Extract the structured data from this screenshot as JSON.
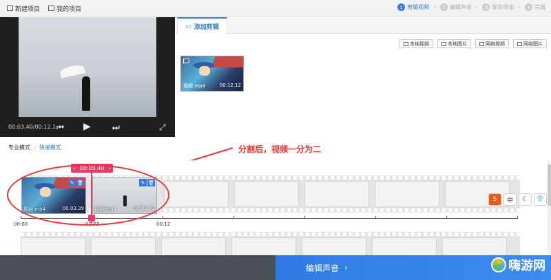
{
  "topbar": {
    "new_project": "新建项目",
    "my_projects": "我的项目",
    "steps": [
      {
        "num": "1",
        "label": "剪辑视频",
        "active": true
      },
      {
        "num": "2",
        "label": "编辑声音",
        "active": false
      },
      {
        "num": "3",
        "label": "保存导出",
        "active": false
      },
      {
        "num": "4",
        "label": "完成",
        "active": false
      }
    ]
  },
  "player": {
    "time": "00:03.40/00:12.1"
  },
  "add_panel": {
    "tab_label": "添加剪辑",
    "sources": [
      "本地视频",
      "本地图片",
      "网络视频",
      "网络图片"
    ],
    "clip": {
      "name": "视频.mp4",
      "duration": "00:12.12"
    }
  },
  "modes": {
    "pro": "专业模式",
    "fast": "快速模式"
  },
  "annotation": "分割后，视频一分为二",
  "timeline": {
    "playhead_time": "00:03.40",
    "clips": [
      {
        "name": "视频.mp4",
        "duration": "00:03.39"
      },
      {
        "name": "视频.mp4",
        "duration": "00:08.72"
      }
    ],
    "ticks": [
      "00:00",
      "00:03",
      "00:12"
    ]
  },
  "ime": [
    "S",
    "中",
    "☾",
    "👕"
  ],
  "bottom": {
    "next_label": "编辑声音",
    "brand": "嗨游网"
  }
}
